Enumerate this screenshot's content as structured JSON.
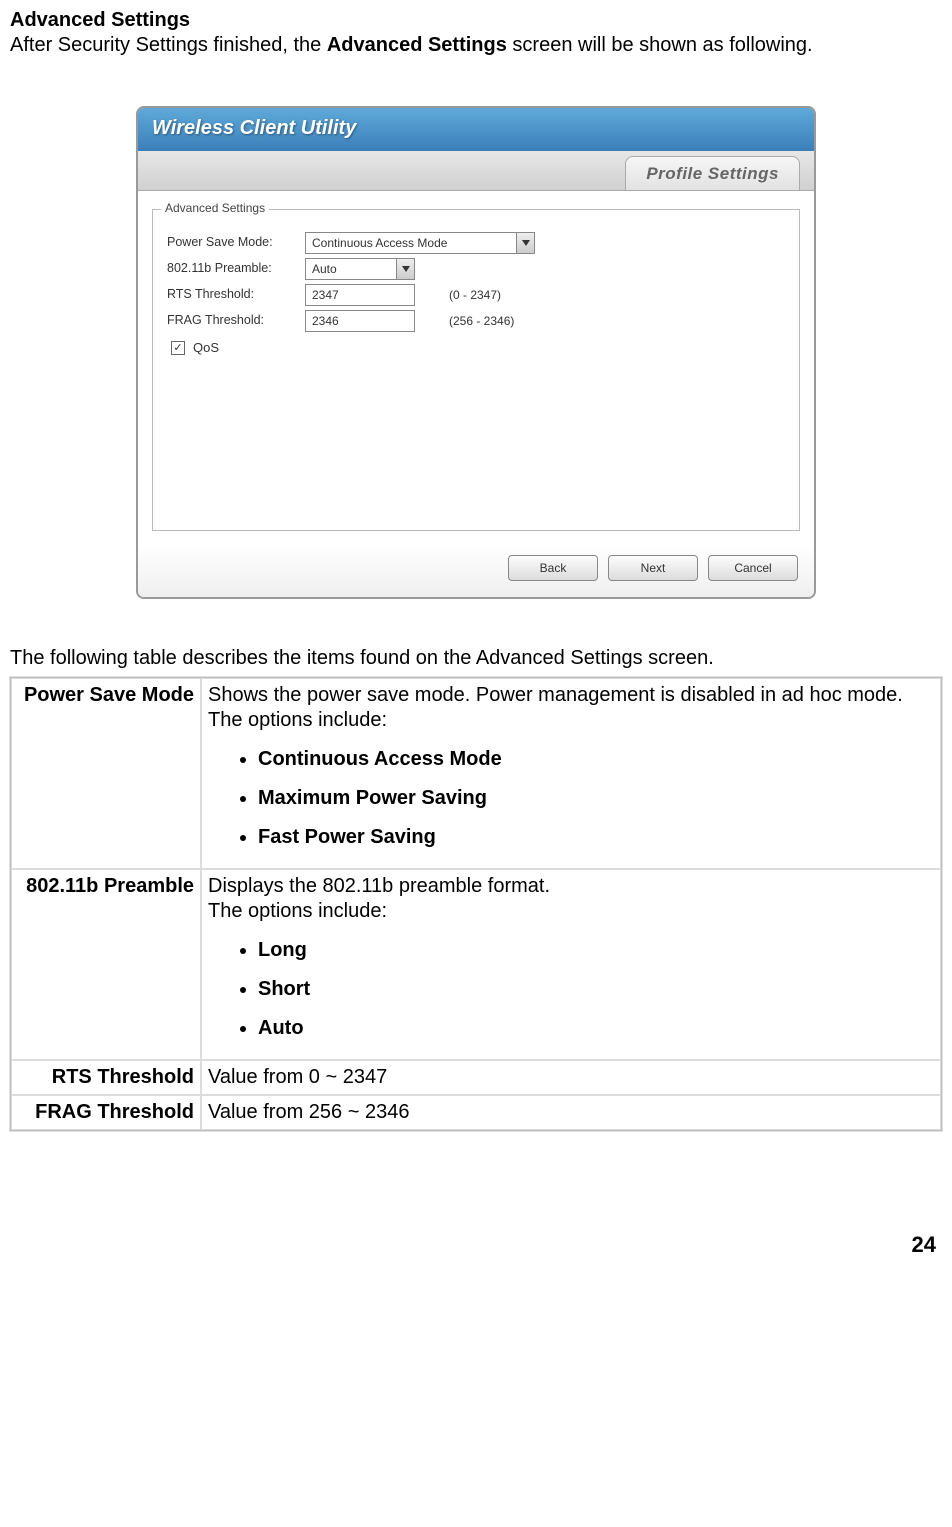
{
  "section_title": "Advanced Settings",
  "section_intro_prefix": "After Security Settings finished, the ",
  "section_intro_bold": "Advanced Settings",
  "section_intro_suffix": " screen will be shown as following.",
  "desc_table_intro": "The following table describes the items found on the Advanced Settings screen.",
  "page_number": "24",
  "window": {
    "app_title": "Wireless Client Utility",
    "tab_label": "Profile Settings",
    "legend": "Advanced Settings",
    "power_label": "Power Save Mode:",
    "power_value": "Continuous Access Mode",
    "preamble_label": "802.11b Preamble:",
    "preamble_value": "Auto",
    "rts_label": "RTS Threshold:",
    "rts_value": "2347",
    "rts_hint": "(0 - 2347)",
    "frag_label": "FRAG Threshold:",
    "frag_value": "2346",
    "frag_hint": "(256 - 2346)",
    "qos_label": "QoS",
    "qos_check": "✓",
    "btn_back": "Back",
    "btn_next": "Next",
    "btn_cancel": "Cancel"
  },
  "table": [
    {
      "name": "Power Save Mode",
      "desc": "Shows the power save mode. Power management is disabled in ad hoc mode. The options include:",
      "opts_intro": "",
      "options": [
        "Continuous Access Mode",
        "Maximum Power Saving",
        "Fast Power Saving"
      ]
    },
    {
      "name": "802.11b Preamble",
      "desc": "Displays the 802.11b preamble format.",
      "opts_intro": "The options include:",
      "options": [
        "Long",
        "Short",
        "Auto"
      ]
    },
    {
      "name": "RTS  Threshold",
      "desc": "Value from 0 ~ 2347"
    },
    {
      "name": "FRAG  Threshold",
      "desc": "Value from 256 ~ 2346"
    }
  ]
}
